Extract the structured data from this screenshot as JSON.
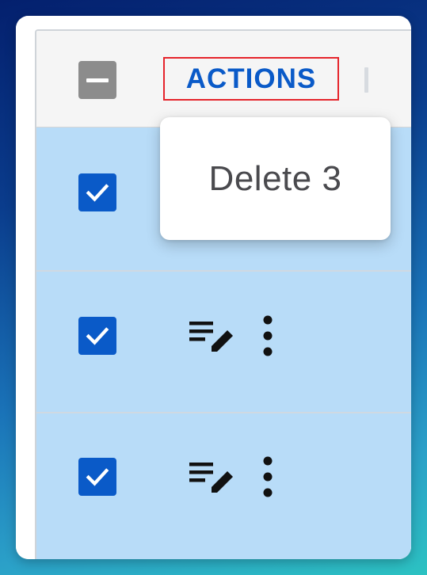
{
  "grid": {
    "header": {
      "select_all_state": "indeterminate",
      "actions_label": "ACTIONS"
    },
    "rows": [
      {
        "selected": true,
        "edit_icon": "edit-note-icon",
        "menu_icon": "more-vert-icon"
      },
      {
        "selected": true,
        "edit_icon": "edit-note-icon",
        "menu_icon": "more-vert-icon"
      },
      {
        "selected": true,
        "edit_icon": "edit-note-icon",
        "menu_icon": "more-vert-icon"
      }
    ]
  },
  "popup": {
    "delete_label": "Delete 3"
  },
  "colors": {
    "accent": "#0a5ac8",
    "selected_row": "#b8dcf8",
    "header_bg": "#f5f5f5",
    "highlight_border": "#e5242b",
    "indeterminate_checkbox": "#8c8c8c"
  }
}
